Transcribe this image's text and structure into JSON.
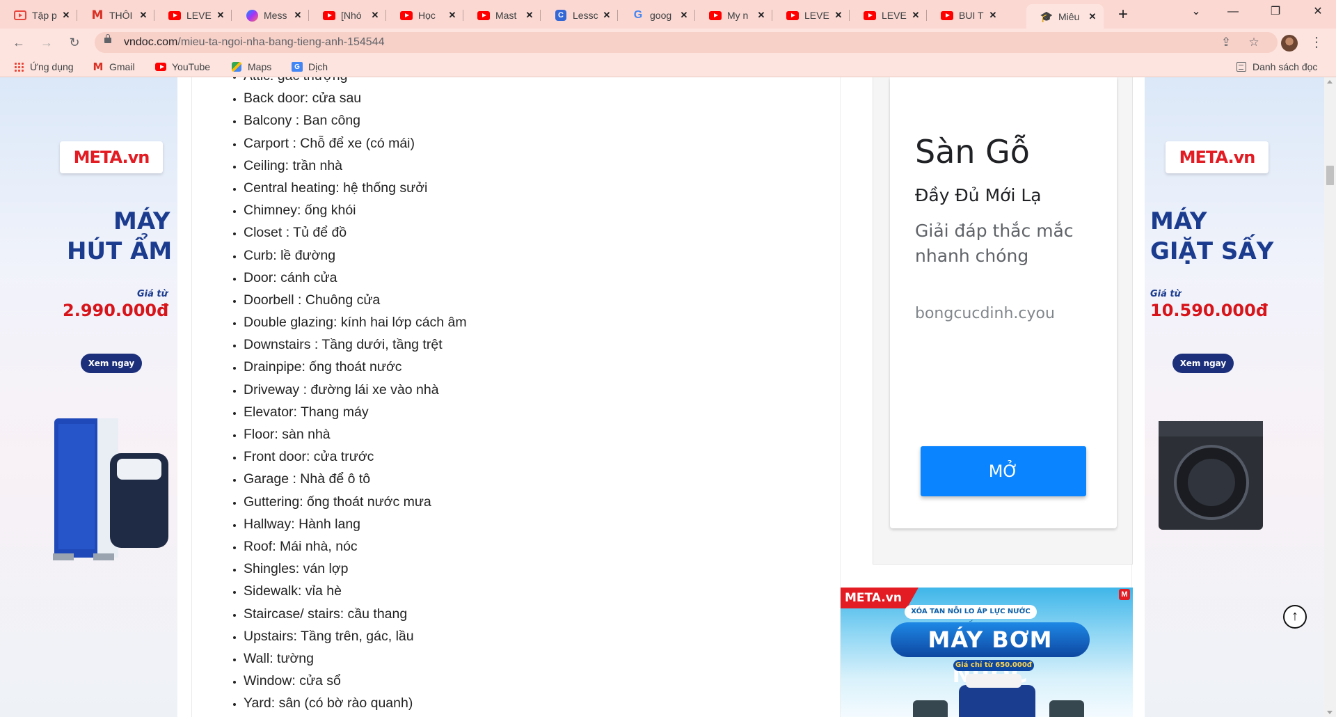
{
  "tabs": [
    {
      "title": "Tập p",
      "icon": "youtube-outline-icon"
    },
    {
      "title": "THÔI",
      "icon": "gmail-icon"
    },
    {
      "title": "LEVE",
      "icon": "youtube-icon"
    },
    {
      "title": "Mess",
      "icon": "messenger-icon"
    },
    {
      "title": "[Nhó",
      "icon": "youtube-icon"
    },
    {
      "title": "Học",
      "icon": "youtube-icon"
    },
    {
      "title": "Mast",
      "icon": "youtube-icon"
    },
    {
      "title": "Lessc",
      "icon": "c-app-icon"
    },
    {
      "title": "goog",
      "icon": "google-icon"
    },
    {
      "title": "My n",
      "icon": "youtube-icon"
    },
    {
      "title": "LEVE",
      "icon": "youtube-icon"
    },
    {
      "title": "LEVE",
      "icon": "youtube-icon"
    },
    {
      "title": "BUI T",
      "icon": "youtube-icon"
    },
    {
      "title": "Miêu",
      "icon": "vndoc-hat-icon",
      "active": true
    }
  ],
  "address_bar": {
    "domain": "vndoc.com",
    "path": "/mieu-ta-ngoi-nha-bang-tieng-anh-154544"
  },
  "bookmarks": {
    "apps": "Ứng dụng",
    "gmail": "Gmail",
    "youtube": "YouTube",
    "maps": "Maps",
    "translate": "Dịch",
    "reading_list": "Danh sách đọc"
  },
  "vocabulary": [
    "Attic: gác thượng",
    "Back door: cửa sau",
    "Balcony : Ban công",
    "Carport : Chỗ để xe (có mái)",
    "Ceiling: trần nhà",
    "Central heating: hệ thống sưởi",
    "Chimney: ống khói",
    "Closet : Tủ để đồ",
    "Curb: lề đường",
    "Door: cánh cửa",
    "Doorbell : Chuông cửa",
    "Double glazing: kính hai lớp cách âm",
    "Downstairs : Tầng dưới, tầng trệt",
    "Drainpipe: ống thoát nước",
    "Driveway : đường lái xe vào nhà",
    "Elevator: Thang máy",
    "Floor: sàn nhà",
    "Front door: cửa trước",
    "Garage : Nhà để ô tô",
    "Guttering: ống thoát nước mưa",
    "Hallway: Hành lang",
    "Roof: Mái nhà, nóc",
    "Shingles: ván lợp",
    "Sidewalk: vỉa hè",
    "Staircase/ stairs: cầu thang",
    "Upstairs: Tầng trên, gác, lầu",
    "Wall: tường",
    "Window: cửa sổ",
    "Yard: sân (có bờ rào quanh)"
  ],
  "left_ad": {
    "logo": "META.vn",
    "line1": "MÁY",
    "line2": "HÚT ẨM",
    "price_label": "Giá từ",
    "price": "2.990.000đ",
    "cta": "Xem ngay"
  },
  "right_ad": {
    "logo": "META.vn",
    "line1": "MÁY",
    "line2": "GIẶT SẤY",
    "price_label": "Giá từ",
    "price": "10.590.000đ",
    "cta": "Xem ngay"
  },
  "display_ad": {
    "title": "Sàn Gỗ",
    "subtitle": "Đầy Đủ Mới Lạ",
    "description": "Giải đáp thắc mắc nhanh chóng",
    "domain": "bongcucdinh.cyou",
    "button": "MỞ"
  },
  "pump_ad": {
    "logo": "META.vn",
    "badge": "M",
    "tagline": "XÓA TAN NỖI LO ÁP LỰC NƯỚC YẾU",
    "title": "MÁY BƠM NƯỚC",
    "price": "Giá chỉ từ 650.000đ"
  },
  "colors": {
    "tabstrip": "#fbd8d1",
    "toolbar": "#fde4de",
    "open_button": "#0a84ff",
    "meta_red": "#e31b23",
    "ad_navy": "#1b3b8f"
  }
}
